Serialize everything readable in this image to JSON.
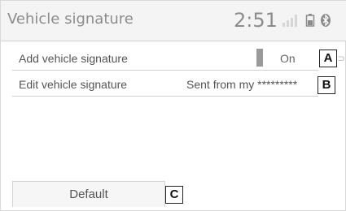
{
  "header": {
    "title": "Vehicle signature",
    "clock": "2:51",
    "icons": [
      "signal-icon",
      "battery-icon",
      "bluetooth-icon"
    ]
  },
  "settings": [
    {
      "label": "Add vehicle signature",
      "value": "On",
      "callout": "A"
    },
    {
      "label": "Edit vehicle signature",
      "value": "Sent from my *********",
      "callout": "B"
    }
  ],
  "footer": {
    "default_label": "Default",
    "callout": "C"
  },
  "colors": {
    "header_bg": "#f4f4f4",
    "text_muted": "#8c8c8c",
    "toggle_indicator": "#9a9a9a",
    "divider": "#d0d0d0"
  }
}
